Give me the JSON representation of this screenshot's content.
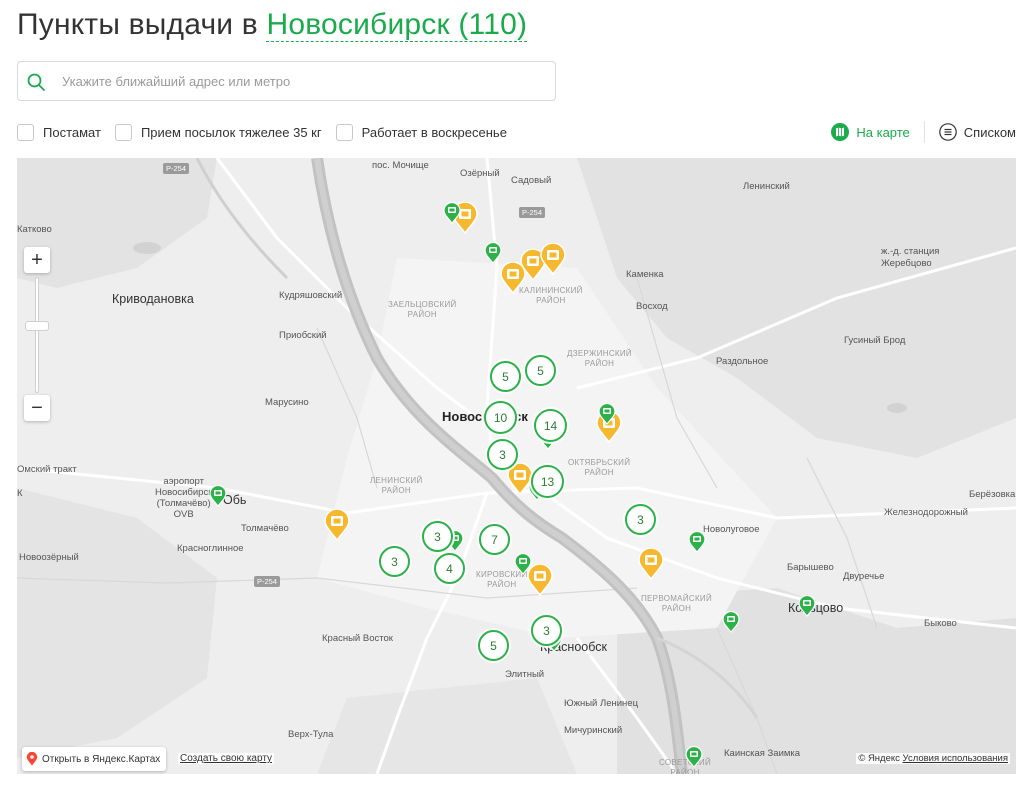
{
  "header": {
    "title_prefix": "Пункты выдачи в",
    "city": "Новосибирск (110)"
  },
  "search": {
    "placeholder": "Укажите ближайший адрес или метро",
    "value": ""
  },
  "filters": [
    {
      "label": "Постамат",
      "checked": false
    },
    {
      "label": "Прием посылок тяжелее 35 кг",
      "checked": false
    },
    {
      "label": "Работает в воскресенье",
      "checked": false
    }
  ],
  "views": {
    "map_label": "На карте",
    "list_label": "Списком",
    "active": "map",
    "map_icon": "map-icon",
    "list_icon": "list-icon"
  },
  "colors": {
    "accent": "#1aab4c",
    "cluster_border": "#2db24a",
    "pin_green": "#2db24a",
    "pin_yellow": "#f5b82e",
    "river": "#bdbdbd",
    "map_bg": "#eeeeee"
  },
  "map": {
    "zoom_in": "+",
    "zoom_out": "−",
    "open_in_yandex": "Открыть в Яндекс.Картах",
    "create_map": "Создать свою карту",
    "copyright": "© Яндекс",
    "terms": "Условия использования",
    "labels": {
      "mochishche": "пос. Мочище",
      "ozerny": "Озёрный",
      "sadovy": "Садовый",
      "leninsky": "Ленинский",
      "katkovo": "Катково",
      "zherebtsovo": "ж.-д. станция\nЖеребцово",
      "kamenka": "Каменка",
      "voskhod": "Восход",
      "krivodanovka": "Криводановка",
      "kudryashovsky": "Кудряшовский",
      "priobsky": "Приобский",
      "gusinybrod": "Гусиный Брод",
      "razdolnoe": "Раздольное",
      "marusino": "Марусино",
      "novosibirsk": "Новосибирск",
      "omsk_trakt": "Омский тракт",
      "airport": "аэропорт\nНовосибирск\n(Толмачёво)\nOVB",
      "ob": "Обь",
      "berezovka": "Берёзовка",
      "zheleznodorozhny": "Железнодорожный",
      "tolmachevo": "Толмачёво",
      "novolugovoe": "Новолуговое",
      "krasnoglinnoe": "Красноглинное",
      "novoozerny": "Новоозёрный",
      "baryshevo": "Барышево",
      "dvurechye": "Двуречье",
      "koltsovo": "Кольцово",
      "bykovo": "Быково",
      "krasny_vostok": "Красный Восток",
      "krasnoobsk": "Краснообск",
      "elitny": "Элитный",
      "yuzhny_leninets": "Южный Ленинец",
      "michurinsky": "Мичуринский",
      "verkh_tula": "Верх-Тула",
      "kainskaya_zaimka": "Каинская Заимка",
      "k_edge": "К",
      "r254_a": "Р-254",
      "r254_b": "Р-254",
      "r254_c": "Р-254",
      "d_zaeltsovsky": "ЗАЕЛЬЦОВСКИЙ\nРАЙОН",
      "d_kalininsky": "КАЛИНИНСКИЙ\nРАЙОН",
      "d_dzerzhinsky": "ДЗЕРЖИНСКИЙ\nРАЙОН",
      "d_oktyabrsky": "ОКТЯБРЬСКИЙ\nРАЙОН",
      "d_leninsky": "ЛЕНИНСКИЙ\nРАЙОН",
      "d_kirovsky": "КИРОВСКИЙ\nРАЙОН",
      "d_pervomaisky": "ПЕРВОМАЙСКИЙ\nРАЙОН",
      "d_sovetsky": "СОВЕТСКИЙ\nРАЙОН"
    },
    "clusters": [
      "5",
      "5",
      "10",
      "14",
      "3",
      "13",
      "3",
      "3",
      "7",
      "3",
      "4",
      "3",
      "5"
    ]
  }
}
